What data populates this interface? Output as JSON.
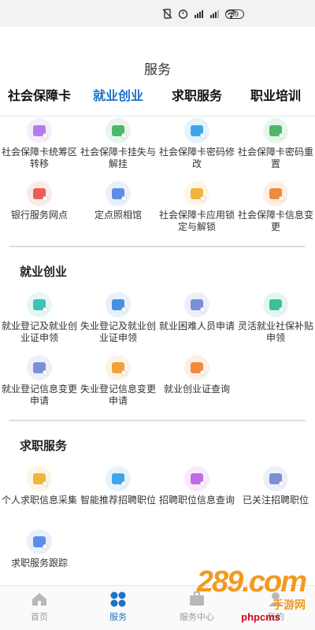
{
  "status_bar": {
    "icons": [
      "vibrate-off-icon",
      "alarm-icon",
      "hd-signal-icon",
      "signal-icon",
      "wifi-icon"
    ],
    "battery": "89"
  },
  "header": {
    "title": "服务"
  },
  "tabs": [
    {
      "label": "社会保障卡",
      "active": false
    },
    {
      "label": "就业创业",
      "active": true
    },
    {
      "label": "求职服务",
      "active": false
    },
    {
      "label": "职业培训",
      "active": false
    }
  ],
  "section_social": {
    "items": [
      {
        "label": "社会保障卡统筹区转移",
        "icon": "transfer-icon",
        "color": "#b57be8"
      },
      {
        "label": "社会保障卡挂失与解挂",
        "icon": "card-lock-icon",
        "color": "#4cb86a"
      },
      {
        "label": "社会保障卡密码修改",
        "icon": "card-edit-icon",
        "color": "#3ea6e8"
      },
      {
        "label": "社会保障卡密码重置",
        "icon": "lock-reset-icon",
        "color": "#4cb86a"
      },
      {
        "label": "银行服务网点",
        "icon": "bank-icon",
        "color": "#e8605a"
      },
      {
        "label": "定点照相馆",
        "icon": "camera-icon",
        "color": "#5b8ee6"
      },
      {
        "label": "社会保障卡应用锁定与解锁",
        "icon": "card-app-lock-icon",
        "color": "#f2b43a"
      },
      {
        "label": "社会保障卡信息变更",
        "icon": "card-info-icon",
        "color": "#f08a3c"
      }
    ]
  },
  "section_employment": {
    "title": "就业创业",
    "items": [
      {
        "label": "就业登记及就业创业证申领",
        "icon": "employment-card-icon",
        "color": "#3cc4b4"
      },
      {
        "label": "失业登记及就业创业证申领",
        "icon": "unemployment-card-icon",
        "color": "#4a90e2"
      },
      {
        "label": "就业困难人员申请",
        "icon": "briefcase-icon",
        "color": "#7a8fd6"
      },
      {
        "label": "灵活就业社保补贴申领",
        "icon": "subsidy-icon",
        "color": "#3cbf9a"
      },
      {
        "label": "就业登记信息变更申请",
        "icon": "employment-change-icon",
        "color": "#7a8fd6"
      },
      {
        "label": "失业登记信息变更申请",
        "icon": "unemployment-change-icon",
        "color": "#f2a23a"
      },
      {
        "label": "就业创业证查询",
        "icon": "certificate-search-icon",
        "color": "#f08a3c"
      }
    ]
  },
  "section_job": {
    "title": "求职服务",
    "items": [
      {
        "label": "个人求职信息采集",
        "icon": "resume-icon",
        "color": "#f2b43a"
      },
      {
        "label": "智能推荐招聘职位",
        "icon": "recommend-job-icon",
        "color": "#3ea6e8"
      },
      {
        "label": "招聘职位信息查询",
        "icon": "job-search-icon",
        "color": "#c36be0"
      },
      {
        "label": "已关注招聘职位",
        "icon": "followed-job-icon",
        "color": "#7a8fd6"
      },
      {
        "label": "求职服务跟踪",
        "icon": "tracking-icon",
        "color": "#5b8ee6"
      }
    ]
  },
  "bottom_nav": [
    {
      "label": "首页",
      "icon": "home-icon",
      "active": false
    },
    {
      "label": "服务",
      "icon": "services-icon",
      "active": true
    },
    {
      "label": "服务中心",
      "icon": "service-center-icon",
      "active": false
    },
    {
      "label": "我的",
      "icon": "profile-icon",
      "active": false
    }
  ],
  "watermark": {
    "logo": "289.com",
    "sub": "手游网",
    "site": "phpcms"
  },
  "colors": {
    "accent": "#1b73c8"
  }
}
